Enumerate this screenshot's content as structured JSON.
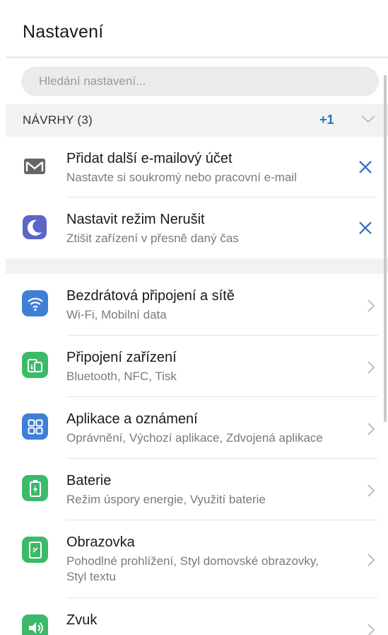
{
  "header": {
    "title": "Nastavení"
  },
  "search": {
    "placeholder": "Hledání nastavení..."
  },
  "suggestions": {
    "title": "NÁVRHY (3)",
    "more_count": "+1",
    "items": [
      {
        "title": "Přidat další e-mailový účet",
        "subtitle": "Nastavte si soukromý nebo pracovní e-mail",
        "icon": "mail-icon"
      },
      {
        "title": "Nastavit režim Nerušit",
        "subtitle": "Ztišit zařízení v přesně daný čas",
        "icon": "moon-icon"
      }
    ]
  },
  "settings": {
    "items": [
      {
        "title": "Bezdrátová připojení a sítě",
        "subtitle": "Wi-Fi, Mobilní data",
        "icon": "wifi-icon"
      },
      {
        "title": "Připojení zařízení",
        "subtitle": "Bluetooth, NFC, Tisk",
        "icon": "device-connection-icon"
      },
      {
        "title": "Aplikace a oznámení",
        "subtitle": "Oprávnění, Výchozí aplikace, Zdvojená aplikace",
        "icon": "apps-icon"
      },
      {
        "title": "Baterie",
        "subtitle": "Režim úspory energie, Využití baterie",
        "icon": "battery-icon"
      },
      {
        "title": "Obrazovka",
        "subtitle_line1": "Pohodlné prohlížení, Styl domovské obrazovky,",
        "subtitle_line2": "Styl textu",
        "icon": "display-icon"
      },
      {
        "title": "Zvuk",
        "subtitle": "",
        "icon": "sound-icon"
      }
    ]
  },
  "colors": {
    "accent_blue": "#2a6cc4",
    "icon_blue": "#3f7fd6",
    "icon_green": "#3cba6a"
  }
}
